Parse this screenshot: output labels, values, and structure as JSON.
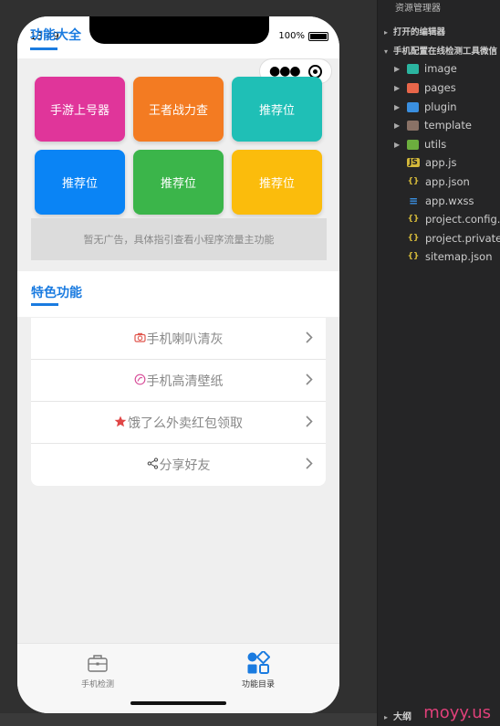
{
  "status": {
    "time": "13:49",
    "battery": "100%"
  },
  "page": {
    "title": "功能大全"
  },
  "grid": [
    {
      "label": "手游上号器",
      "color": "#e0359a"
    },
    {
      "label": "王者战力查",
      "color": "#f37b22"
    },
    {
      "label": "推荐位",
      "color": "#1fbfb6"
    },
    {
      "label": "推荐位",
      "color": "#0a84f5"
    },
    {
      "label": "推荐位",
      "color": "#3bb54a"
    },
    {
      "label": "推荐位",
      "color": "#fbbc0c"
    }
  ],
  "ad": {
    "text": "暂无广告，具体指引查看小程序流量主功能"
  },
  "section": {
    "title": "特色功能"
  },
  "features": [
    {
      "label": "手机喇叭清灰",
      "icon": "camera-icon",
      "icon_color": "#e0564d"
    },
    {
      "label": "手机高清壁纸",
      "icon": "wallpaper-icon",
      "icon_color": "#d8509a"
    },
    {
      "label": "饿了么外卖红包领取",
      "icon": "star-icon",
      "icon_color": "#e04646"
    },
    {
      "label": "分享好友",
      "icon": "share-icon",
      "icon_color": "#555555"
    }
  ],
  "tabbar": {
    "left": {
      "label": "手机检测",
      "icon": "toolbox-icon"
    },
    "right": {
      "label": "功能目录",
      "icon": "category-icon",
      "icon_color": "#1a7be0"
    }
  },
  "explorer": {
    "header": "资源管理器",
    "open_editors": "打开的编辑器",
    "project": "手机配置在线检测工具微信",
    "folders": [
      "image",
      "pages",
      "plugin",
      "template",
      "utils"
    ],
    "files": [
      "app.js",
      "app.json",
      "app.wxss",
      "project.config.js",
      "project.private.c",
      "sitemap.json"
    ],
    "outline": "大纲"
  },
  "watermark": "moyy.us"
}
